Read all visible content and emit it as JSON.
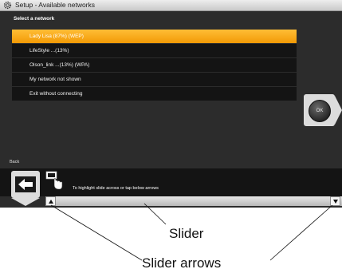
{
  "window": {
    "title": "Setup - Available networks",
    "icon": "gear-icon"
  },
  "section": {
    "label": "Select a network"
  },
  "networks": [
    {
      "label": "Lady Lisa (87%) (WEP)",
      "selected": true
    },
    {
      "label": "LifeStyle ...(13%)",
      "selected": false
    },
    {
      "label": "Olson_link ...(13%) (WPA)",
      "selected": false
    },
    {
      "label": "My network not shown",
      "selected": false
    },
    {
      "label": "Exit without connecting",
      "selected": false
    }
  ],
  "ok_button": {
    "label": "OK"
  },
  "back": {
    "label": "Back",
    "icon": "left-arrow-icon"
  },
  "hint": {
    "text": "To highlight slide across or tap below arrows",
    "icon": "hand-tap-icon"
  },
  "slider": {
    "left_arrow_icon": "up-triangle-icon",
    "right_arrow_icon": "down-triangle-icon"
  },
  "callouts": {
    "slider": "Slider",
    "slider_arrows": "Slider arrows"
  },
  "colors": {
    "selected_row": "#f7a81b",
    "background": "#2c2c2c",
    "row": "#141414"
  }
}
